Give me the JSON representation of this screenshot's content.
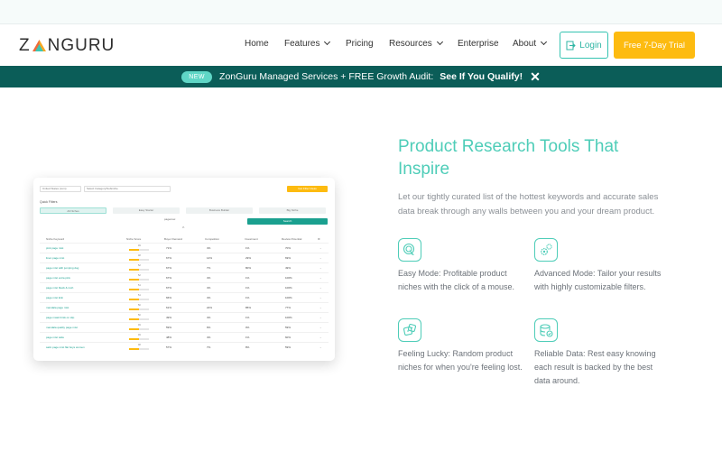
{
  "header": {
    "logo_text_left": "Z",
    "logo_text_right": "NGURU",
    "menu": [
      {
        "label": "Home"
      },
      {
        "label": "Features"
      },
      {
        "label": "Pricing"
      },
      {
        "label": "Resources"
      },
      {
        "label": "Enterprise"
      },
      {
        "label": "About"
      }
    ],
    "login_label": "Login",
    "trial_label": "Free 7-Day Trial",
    "colors": {
      "teal": "#35c3b1",
      "yellow": "#fdbb10",
      "banner": "#0b5d58"
    }
  },
  "banner": {
    "badge": "NEW",
    "text": "ZonGuru Managed Services + FREE Growth Audit:",
    "cta": "See If You Qualify!",
    "close": "✕"
  },
  "mock": {
    "select_1": "United States (com)",
    "select_2": "Select Category/Subniche",
    "top_button": "Get Filter Ideas",
    "quick_filters": "Quick Filters",
    "tabs": [
      "All Niches",
      "Easy Starter",
      "Business Builder",
      "Big Niche"
    ],
    "pill": "pagemax",
    "search_button": "Search",
    "columns": [
      "Niche Keyword",
      "Niche Score",
      "Buyer Demand",
      "Competition",
      "Investment",
      "Review Potential"
    ],
    "rows": [
      {
        "kw": "pink page mist",
        "score": "49",
        "fill": 0.49,
        "buyer": "71%",
        "comp": "4%",
        "inv": "1%",
        "rev": "70%"
      },
      {
        "kw": "linen page mist",
        "score": "48",
        "fill": 0.48,
        "buyer": "67%",
        "comp": "14%",
        "inv": "29%",
        "rev": "69%"
      },
      {
        "kw": "page mist with jumping dog",
        "score": "52",
        "fill": 0.52,
        "buyer": "67%",
        "comp": "7%",
        "inv": "80%",
        "rev": "49%"
      },
      {
        "kw": "page mist extra pink",
        "score": "52",
        "fill": 0.52,
        "buyer": "67%",
        "comp": "4%",
        "inv": "1%",
        "rev": "100%"
      },
      {
        "kw": "page mist black & rush",
        "score": "51",
        "fill": 0.51,
        "buyer": "67%",
        "comp": "4%",
        "inv": "1%",
        "rev": "100%"
      },
      {
        "kw": "page mist Erin",
        "score": "51",
        "fill": 0.51,
        "buyer": "66%",
        "comp": "4%",
        "inv": "1%",
        "rev": "100%"
      },
      {
        "kw": "mandala page mist",
        "score": "50",
        "fill": 0.5,
        "buyer": "61%",
        "comp": "22%",
        "inv": "85%",
        "rev": "77%"
      },
      {
        "kw": "page mask brisk on slip",
        "score": "50",
        "fill": 0.5,
        "buyer": "49%",
        "comp": "4%",
        "inv": "1%",
        "rev": "100%"
      },
      {
        "kw": "mandala quality page mist",
        "score": "49",
        "fill": 0.49,
        "buyer": "59%",
        "comp": "9%",
        "inv": "0%",
        "rev": "59%"
      },
      {
        "kw": "page mist wide",
        "score": "49",
        "fill": 0.49,
        "buyer": "48%",
        "comp": "4%",
        "inv": "1%",
        "rev": "60%"
      },
      {
        "kw": "satin page mist flat boys women",
        "score": "48",
        "fill": 0.48,
        "buyer": "57%",
        "comp": "7%",
        "inv": "8%",
        "rev": "59%"
      }
    ]
  },
  "hero": {
    "title_line1": "Product Research Tools That",
    "title_line2": "Inspire",
    "description": "Let our tightly curated list of the hottest keywords and accurate sales data break through any walls between you and your dream product."
  },
  "features": [
    {
      "icon": "target-cursor-icon",
      "text": "Easy Mode: Profitable product niches with the click of a mouse."
    },
    {
      "icon": "gears-icon",
      "text": "Advanced Mode: Tailor your results with highly customizable filters."
    },
    {
      "icon": "dice-icon",
      "text": "Feeling Lucky: Random product niches for when you're feeling lost."
    },
    {
      "icon": "database-check-icon",
      "text": "Reliable Data: Rest easy knowing each result is backed by the best data around."
    }
  ]
}
